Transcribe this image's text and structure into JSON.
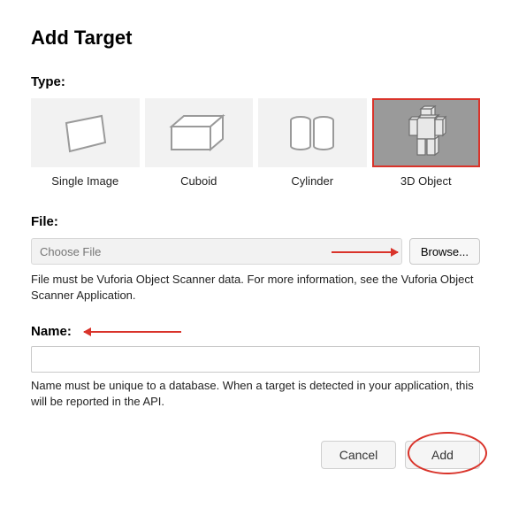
{
  "title": "Add Target",
  "type": {
    "label": "Type:",
    "items": [
      {
        "label": "Single Image"
      },
      {
        "label": "Cuboid"
      },
      {
        "label": "Cylinder"
      },
      {
        "label": "3D Object"
      }
    ],
    "selected_index": 3
  },
  "file": {
    "label": "File:",
    "placeholder": "Choose File",
    "browse_label": "Browse...",
    "help_text": "File must be Vuforia Object Scanner data. For more information, see the Vuforia Object Scanner Application."
  },
  "name": {
    "label": "Name:",
    "value": "",
    "help_text": "Name must be unique to a database. When a target is detected in your application, this will be reported in the API."
  },
  "buttons": {
    "cancel": "Cancel",
    "add": "Add"
  }
}
